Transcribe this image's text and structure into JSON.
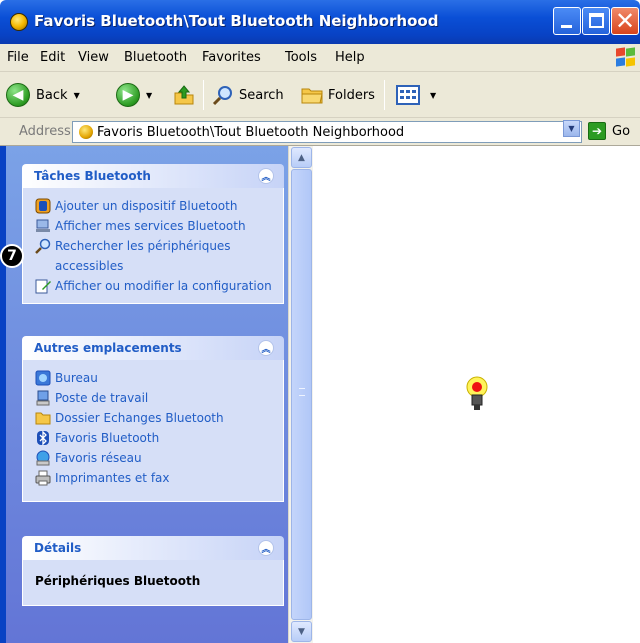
{
  "window": {
    "title": "Favoris Bluetooth\\Tout Bluetooth Neighborhood"
  },
  "menu": [
    "File",
    "Edit",
    "View",
    "Bluetooth",
    "Favorites",
    "Tools",
    "Help"
  ],
  "toolbar": {
    "back": "Back",
    "search": "Search",
    "folders": "Folders"
  },
  "address": {
    "label": "Address",
    "value": "Favoris Bluetooth\\Tout Bluetooth Neighborhood",
    "go": "Go"
  },
  "tasks_panel": {
    "title": "Tâches Bluetooth",
    "items": [
      {
        "label": "Ajouter un dispositif Bluetooth",
        "icon": "add-device-icon"
      },
      {
        "label": "Afficher mes services Bluetooth",
        "icon": "services-icon"
      },
      {
        "label": "Rechercher les périphériques accessibles",
        "icon": "search-icon"
      },
      {
        "label": "Afficher ou modifier la configuration",
        "icon": "config-icon"
      }
    ]
  },
  "places_panel": {
    "title": "Autres emplacements",
    "items": [
      {
        "label": "Bureau",
        "icon": "desktop-icon"
      },
      {
        "label": "Poste de travail",
        "icon": "computer-icon"
      },
      {
        "label": "Dossier Echanges Bluetooth",
        "icon": "folder-icon"
      },
      {
        "label": "Favoris Bluetooth",
        "icon": "bluetooth-icon"
      },
      {
        "label": "Favoris réseau",
        "icon": "network-icon"
      },
      {
        "label": "Imprimantes et fax",
        "icon": "printer-icon"
      }
    ]
  },
  "details_panel": {
    "title": "Détails",
    "text": "Périphériques Bluetooth"
  },
  "callout": {
    "number": "7"
  },
  "colors": {
    "titlebar": "#0a4fd6",
    "taskpane": "#7ba2e7",
    "link": "#215dc6"
  }
}
